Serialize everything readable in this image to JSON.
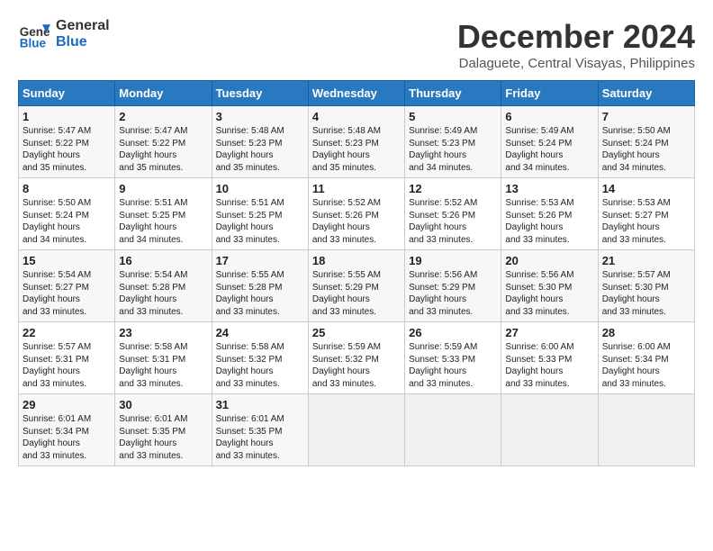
{
  "header": {
    "logo_line1": "General",
    "logo_line2": "Blue",
    "month_year": "December 2024",
    "location": "Dalaguete, Central Visayas, Philippines"
  },
  "weekdays": [
    "Sunday",
    "Monday",
    "Tuesday",
    "Wednesday",
    "Thursday",
    "Friday",
    "Saturday"
  ],
  "weeks": [
    [
      {
        "day": "1",
        "sunrise": "5:47 AM",
        "sunset": "5:22 PM",
        "daylight": "11 hours and 35 minutes."
      },
      {
        "day": "2",
        "sunrise": "5:47 AM",
        "sunset": "5:22 PM",
        "daylight": "11 hours and 35 minutes."
      },
      {
        "day": "3",
        "sunrise": "5:48 AM",
        "sunset": "5:23 PM",
        "daylight": "11 hours and 35 minutes."
      },
      {
        "day": "4",
        "sunrise": "5:48 AM",
        "sunset": "5:23 PM",
        "daylight": "11 hours and 35 minutes."
      },
      {
        "day": "5",
        "sunrise": "5:49 AM",
        "sunset": "5:23 PM",
        "daylight": "11 hours and 34 minutes."
      },
      {
        "day": "6",
        "sunrise": "5:49 AM",
        "sunset": "5:24 PM",
        "daylight": "11 hours and 34 minutes."
      },
      {
        "day": "7",
        "sunrise": "5:50 AM",
        "sunset": "5:24 PM",
        "daylight": "11 hours and 34 minutes."
      }
    ],
    [
      {
        "day": "8",
        "sunrise": "5:50 AM",
        "sunset": "5:24 PM",
        "daylight": "11 hours and 34 minutes."
      },
      {
        "day": "9",
        "sunrise": "5:51 AM",
        "sunset": "5:25 PM",
        "daylight": "11 hours and 34 minutes."
      },
      {
        "day": "10",
        "sunrise": "5:51 AM",
        "sunset": "5:25 PM",
        "daylight": "11 hours and 33 minutes."
      },
      {
        "day": "11",
        "sunrise": "5:52 AM",
        "sunset": "5:26 PM",
        "daylight": "11 hours and 33 minutes."
      },
      {
        "day": "12",
        "sunrise": "5:52 AM",
        "sunset": "5:26 PM",
        "daylight": "11 hours and 33 minutes."
      },
      {
        "day": "13",
        "sunrise": "5:53 AM",
        "sunset": "5:26 PM",
        "daylight": "11 hours and 33 minutes."
      },
      {
        "day": "14",
        "sunrise": "5:53 AM",
        "sunset": "5:27 PM",
        "daylight": "11 hours and 33 minutes."
      }
    ],
    [
      {
        "day": "15",
        "sunrise": "5:54 AM",
        "sunset": "5:27 PM",
        "daylight": "11 hours and 33 minutes."
      },
      {
        "day": "16",
        "sunrise": "5:54 AM",
        "sunset": "5:28 PM",
        "daylight": "11 hours and 33 minutes."
      },
      {
        "day": "17",
        "sunrise": "5:55 AM",
        "sunset": "5:28 PM",
        "daylight": "11 hours and 33 minutes."
      },
      {
        "day": "18",
        "sunrise": "5:55 AM",
        "sunset": "5:29 PM",
        "daylight": "11 hours and 33 minutes."
      },
      {
        "day": "19",
        "sunrise": "5:56 AM",
        "sunset": "5:29 PM",
        "daylight": "11 hours and 33 minutes."
      },
      {
        "day": "20",
        "sunrise": "5:56 AM",
        "sunset": "5:30 PM",
        "daylight": "11 hours and 33 minutes."
      },
      {
        "day": "21",
        "sunrise": "5:57 AM",
        "sunset": "5:30 PM",
        "daylight": "11 hours and 33 minutes."
      }
    ],
    [
      {
        "day": "22",
        "sunrise": "5:57 AM",
        "sunset": "5:31 PM",
        "daylight": "11 hours and 33 minutes."
      },
      {
        "day": "23",
        "sunrise": "5:58 AM",
        "sunset": "5:31 PM",
        "daylight": "11 hours and 33 minutes."
      },
      {
        "day": "24",
        "sunrise": "5:58 AM",
        "sunset": "5:32 PM",
        "daylight": "11 hours and 33 minutes."
      },
      {
        "day": "25",
        "sunrise": "5:59 AM",
        "sunset": "5:32 PM",
        "daylight": "11 hours and 33 minutes."
      },
      {
        "day": "26",
        "sunrise": "5:59 AM",
        "sunset": "5:33 PM",
        "daylight": "11 hours and 33 minutes."
      },
      {
        "day": "27",
        "sunrise": "6:00 AM",
        "sunset": "5:33 PM",
        "daylight": "11 hours and 33 minutes."
      },
      {
        "day": "28",
        "sunrise": "6:00 AM",
        "sunset": "5:34 PM",
        "daylight": "11 hours and 33 minutes."
      }
    ],
    [
      {
        "day": "29",
        "sunrise": "6:01 AM",
        "sunset": "5:34 PM",
        "daylight": "11 hours and 33 minutes."
      },
      {
        "day": "30",
        "sunrise": "6:01 AM",
        "sunset": "5:35 PM",
        "daylight": "11 hours and 33 minutes."
      },
      {
        "day": "31",
        "sunrise": "6:01 AM",
        "sunset": "5:35 PM",
        "daylight": "11 hours and 33 minutes."
      },
      null,
      null,
      null,
      null
    ]
  ]
}
